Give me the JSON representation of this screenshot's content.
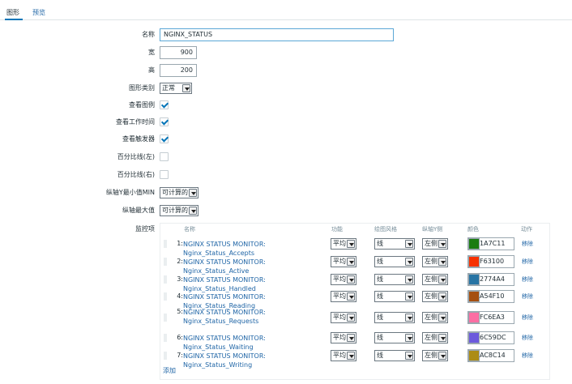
{
  "tabs": [
    {
      "label": "图形",
      "active": true
    },
    {
      "label": "预览",
      "active": false
    }
  ],
  "form": {
    "name_label": "名称",
    "name_value": "NGINX_STATUS",
    "width_label": "宽",
    "width_value": "900",
    "height_label": "高",
    "height_value": "200",
    "graph_type_label": "图形类别",
    "graph_type_value": "正常",
    "show_legend_label": "查看图例",
    "show_legend": true,
    "show_working_time_label": "查看工作时间",
    "show_working_time": true,
    "show_triggers_label": "查看触发器",
    "show_triggers": true,
    "percentile_left_label": "百分比线(左)",
    "percentile_left": false,
    "percentile_right_label": "百分比线(右)",
    "percentile_right": false,
    "ymin_label": "纵轴Y最小值MIN",
    "ymin_value": "可计算的",
    "ymax_label": "纵轴最大值",
    "ymax_value": "可计算的",
    "items_label": "监控项"
  },
  "items_table": {
    "headers": {
      "name": "名称",
      "function": "功能",
      "draw_style": "绘图风格",
      "y_axis": "纵轴Y侧",
      "color": "颜色",
      "action": "动作"
    },
    "rows": [
      {
        "index": "1:",
        "name": "NGINX STATUS MONITOR: Nginx_Status_Accepts",
        "function": "平均",
        "draw_style": "线",
        "y_axis": "左侧",
        "color": "1A7C11",
        "action": "移除"
      },
      {
        "index": "2:",
        "name": "NGINX STATUS MONITOR: Nginx_Status_Active",
        "function": "平均",
        "draw_style": "线",
        "y_axis": "左侧",
        "color": "F63100",
        "action": "移除"
      },
      {
        "index": "3:",
        "name": "NGINX STATUS MONITOR: Nginx_Status_Handled",
        "function": "平均",
        "draw_style": "线",
        "y_axis": "左侧",
        "color": "2774A4",
        "action": "移除"
      },
      {
        "index": "4:",
        "name": "NGINX STATUS MONITOR: Nginx_Status_Reading",
        "function": "平均",
        "draw_style": "线",
        "y_axis": "左侧",
        "color": "A54F10",
        "action": "移除"
      },
      {
        "index": "5:",
        "name": "NGINX STATUS MONITOR: Nginx_Status_Requests",
        "function": "平均",
        "draw_style": "线",
        "y_axis": "左侧",
        "color": "FC6EA3",
        "action": "移除"
      },
      {
        "index": "6:",
        "name": "NGINX STATUS MONITOR: Nginx_Status_Waiting",
        "function": "平均",
        "draw_style": "线",
        "y_axis": "左侧",
        "color": "6C59DC",
        "action": "移除"
      },
      {
        "index": "7:",
        "name": "NGINX STATUS MONITOR: Nginx_Status_Writing",
        "function": "平均",
        "draw_style": "线",
        "y_axis": "左侧",
        "color": "AC8C14",
        "action": "移除"
      }
    ],
    "add_label": "添加"
  }
}
